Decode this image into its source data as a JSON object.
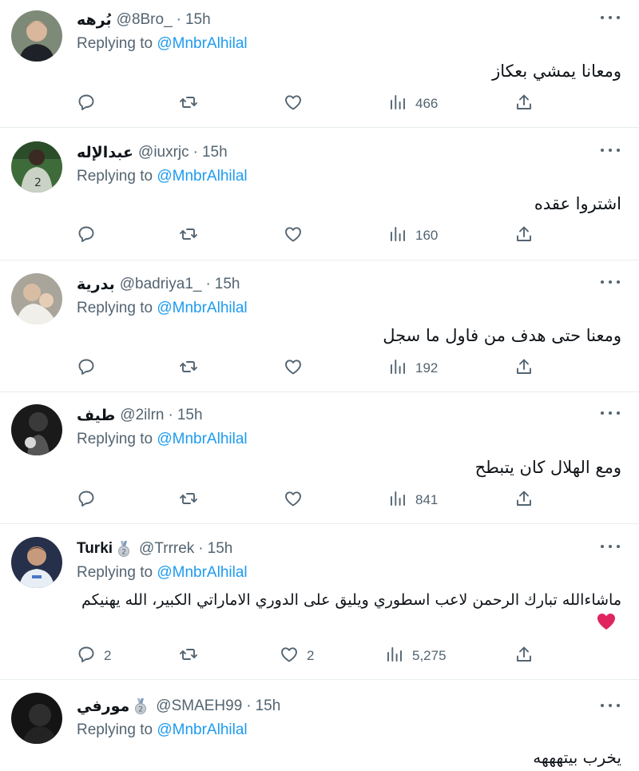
{
  "colors": {
    "accent": "#1d9bf0",
    "muted": "#536471",
    "text": "#0f1419",
    "divider": "#e6ecf0"
  },
  "tweets": [
    {
      "name": "بُرهه",
      "handle": "@8Bro_",
      "time": "15h",
      "badge": false,
      "replying_prefix": "Replying to ",
      "replying_to": "@MnbrAlhilal",
      "text": "ومعانا يمشي بعكاز",
      "reply_count": "",
      "retweet_count": "",
      "like_count": "",
      "views": "466"
    },
    {
      "name": "عبدالإله",
      "handle": "@iuxrjc",
      "time": "15h",
      "badge": false,
      "replying_prefix": "Replying to ",
      "replying_to": "@MnbrAlhilal",
      "text": "اشتروا عقده",
      "reply_count": "",
      "retweet_count": "",
      "like_count": "",
      "views": "160"
    },
    {
      "name": "بدرية",
      "handle": "@badriya1_",
      "time": "15h",
      "badge": false,
      "replying_prefix": "Replying to ",
      "replying_to": "@MnbrAlhilal",
      "text": "ومعنا حتى هدف من فاول ما سجل",
      "reply_count": "",
      "retweet_count": "",
      "like_count": "",
      "views": "192"
    },
    {
      "name": "طيف",
      "handle": "@2ilrn",
      "time": "15h",
      "badge": false,
      "replying_prefix": "Replying to ",
      "replying_to": "@MnbrAlhilal",
      "text": "ومع الهلال كان يتبطح",
      "reply_count": "",
      "retweet_count": "",
      "like_count": "",
      "views": "841"
    },
    {
      "name": "Turki",
      "handle": "@Trrrek",
      "time": "15h",
      "badge": true,
      "replying_prefix": "Replying to ",
      "replying_to": "@MnbrAlhilal",
      "text": "ماشاءالله تبارك الرحمن لاعب اسطوري ويليق على الدوري الاماراتي الكبير، الله يهنيكم",
      "reply_count": "2",
      "retweet_count": "",
      "like_count": "2",
      "views": "5,275"
    },
    {
      "name": "مورفي",
      "handle": "@SMAEH99",
      "time": "15h",
      "badge": true,
      "replying_prefix": "Replying to ",
      "replying_to": "@MnbrAlhilal",
      "text": "يخرب بيتهههه",
      "reply_count": "",
      "retweet_count": "",
      "like_count": "",
      "views": ""
    }
  ]
}
